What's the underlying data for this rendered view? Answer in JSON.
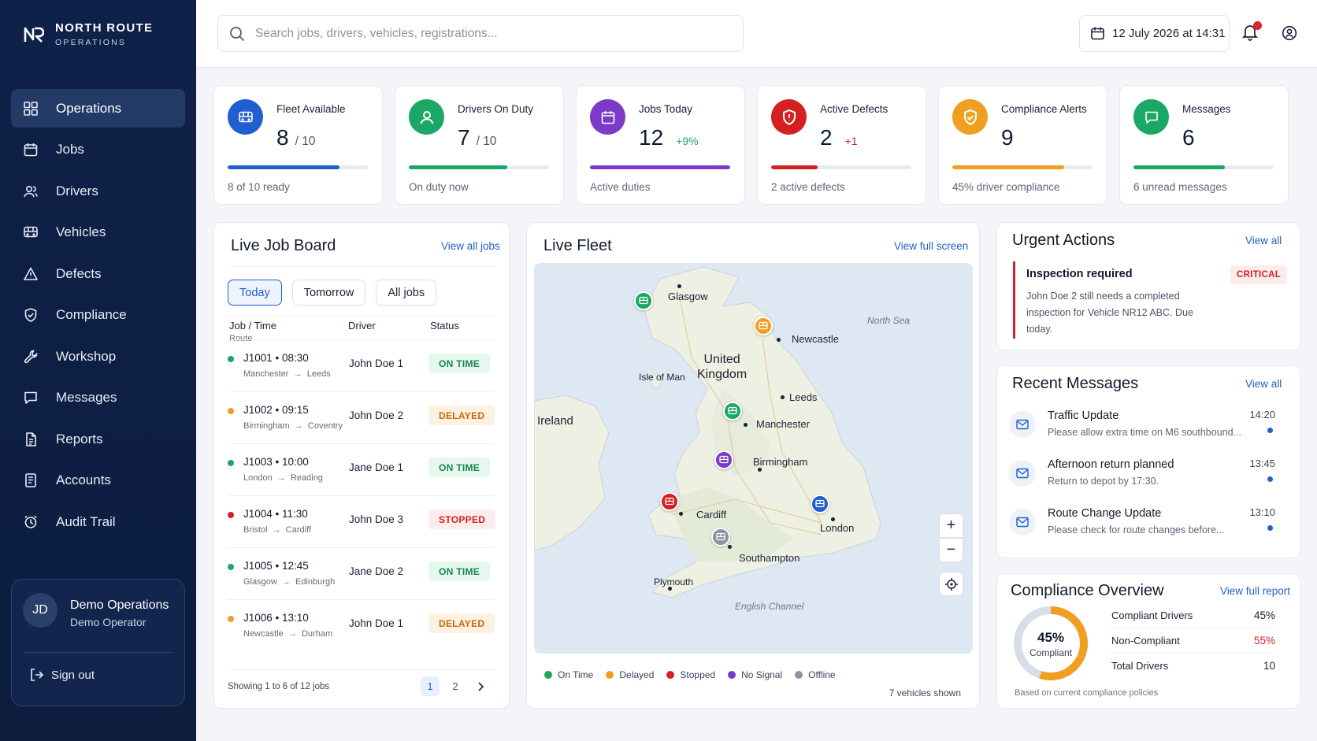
{
  "brand": {
    "name": "NORTH ROUTE",
    "sub": "OPERATIONS"
  },
  "nav": [
    {
      "label": "Operations",
      "icon": "grid-icon",
      "active": true
    },
    {
      "label": "Jobs",
      "icon": "calendar-icon"
    },
    {
      "label": "Drivers",
      "icon": "users-icon"
    },
    {
      "label": "Vehicles",
      "icon": "bus-icon"
    },
    {
      "label": "Defects",
      "icon": "warning-icon"
    },
    {
      "label": "Compliance",
      "icon": "shield-icon"
    },
    {
      "label": "Workshop",
      "icon": "wrench-icon"
    },
    {
      "label": "Messages",
      "icon": "chat-icon"
    },
    {
      "label": "Reports",
      "icon": "report-icon"
    },
    {
      "label": "Accounts",
      "icon": "ledger-icon"
    },
    {
      "label": "Audit Trail",
      "icon": "audit-icon"
    }
  ],
  "user": {
    "initials": "JD",
    "name": "Demo Operations",
    "role": "Demo Operator",
    "signout": "Sign out"
  },
  "topbar": {
    "search_placeholder": "Search jobs, drivers, vehicles, registrations...",
    "datetime": "12 July 2026 at 14:31"
  },
  "kpis": [
    {
      "label": "Fleet Available",
      "value": "8",
      "sub": "/ 10",
      "delta": "",
      "note": "8 of 10 ready",
      "progress": 0.8,
      "color": "#1f5fd0",
      "icon": "bus-icon"
    },
    {
      "label": "Drivers On Duty",
      "value": "7",
      "sub": "/ 10",
      "delta": "",
      "note": "On duty now",
      "progress": 0.7,
      "color": "#1ba865",
      "icon": "user-icon"
    },
    {
      "label": "Jobs Today",
      "value": "12",
      "sub": "",
      "delta": "+9%",
      "note": "Active duties",
      "progress": 1.0,
      "color": "#7a3cc8",
      "icon": "calendar-icon"
    },
    {
      "label": "Active Defects",
      "value": "2",
      "sub": "",
      "delta": "+1",
      "note": "2 active defects",
      "progress": 0.33,
      "color": "#d42020",
      "icon": "shield-alert-icon"
    },
    {
      "label": "Compliance Alerts",
      "value": "9",
      "sub": "",
      "delta": "",
      "note": "45% driver compliance",
      "progress": 0.8,
      "color": "#f0a021",
      "icon": "shield-check-icon"
    },
    {
      "label": "Messages",
      "value": "6",
      "sub": "",
      "delta": "",
      "note": "6 unread messages",
      "progress": 0.65,
      "color": "#1ba865",
      "icon": "chat-icon"
    }
  ],
  "jobboard": {
    "title": "Live Job Board",
    "link": "View all jobs",
    "tabs": [
      "Today",
      "Tomorrow",
      "All jobs"
    ],
    "headers": {
      "job": "Job /  Time",
      "route": "Route",
      "driver": "Driver",
      "status": "Status"
    },
    "rows": [
      {
        "job": "J1001",
        "time": "08:30",
        "from": "Manchester",
        "to": "Leeds",
        "driver": "John Doe 1",
        "status": "ON TIME",
        "kind": "ontime"
      },
      {
        "job": "J1002",
        "time": "09:15",
        "from": "Birmingham",
        "to": "Coventry",
        "driver": "John Doe 2",
        "status": "DELAYED",
        "kind": "delayed"
      },
      {
        "job": "J1003",
        "time": "10:00",
        "from": "London",
        "to": "Reading",
        "driver": "Jane Doe 1",
        "status": "ON TIME",
        "kind": "ontime"
      },
      {
        "job": "J1004",
        "time": "11:30",
        "from": "Bristol",
        "to": "Cardiff",
        "driver": "John Doe 3",
        "status": "STOPPED",
        "kind": "stopped"
      },
      {
        "job": "J1005",
        "time": "12:45",
        "from": "Glasgow",
        "to": "Edinburgh",
        "driver": "Jane Doe 2",
        "status": "ON TIME",
        "kind": "ontime"
      },
      {
        "job": "J1006",
        "time": "13:10",
        "from": "Newcastle",
        "to": "Durham",
        "driver": "John Doe 1",
        "status": "DELAYED",
        "kind": "delayed"
      }
    ],
    "footer": "Showing 1 to 6 of 12 jobs",
    "pages": [
      "1",
      "2"
    ]
  },
  "fleet": {
    "title": "Live Fleet",
    "link": "View full screen",
    "labels": {
      "north_sea": "North Sea",
      "uk1": "United",
      "uk2": "Kingdom",
      "ireland": "Ireland",
      "isle_of_man": "Isle of Man",
      "channel": "English Channel"
    },
    "cities": [
      "Glasgow",
      "Newcastle",
      "Leeds",
      "Manchester",
      "Birmingham",
      "Cardiff",
      "London",
      "Southampton",
      "Plymouth"
    ],
    "legend": [
      "On Time",
      "Delayed",
      "Stopped",
      "No Signal",
      "Offline"
    ],
    "status_colors": {
      "ontime": "#1ba865",
      "delayed": "#f0a021",
      "stopped": "#d42020",
      "nosignal": "#7a3cc8",
      "offline": "#8a93a3",
      "moving": "#1f5fd0"
    },
    "shown": "7 vehicles shown"
  },
  "urgent": {
    "title": "Urgent Actions",
    "link": "View all",
    "item_title": "Inspection required",
    "tag": "CRITICAL",
    "text": "John Doe 2 still needs a completed inspection for Vehicle NR12 ABC. Due today."
  },
  "messages": {
    "title": "Recent Messages",
    "link": "View all",
    "items": [
      {
        "title": "Traffic Update",
        "snippet": "Please allow extra time on M6 southbound...",
        "time": "14:20"
      },
      {
        "title": "Afternoon return planned",
        "snippet": "Return to depot by 17:30.",
        "time": "13:45"
      },
      {
        "title": "Route Change Update",
        "snippet": "Please check for route changes before...",
        "time": "13:10"
      }
    ]
  },
  "compliance": {
    "title": "Compliance Overview",
    "link": "View full report",
    "donut_value": "45%",
    "donut_label": "Compliant",
    "donut_fraction": 0.45,
    "rows": [
      {
        "label": "Compliant Drivers",
        "value": "45%"
      },
      {
        "label": "Non-Compliant",
        "value": "55%"
      },
      {
        "label": "Total Drivers",
        "value": "10"
      }
    ],
    "footer": "Based on current compliance policies"
  }
}
